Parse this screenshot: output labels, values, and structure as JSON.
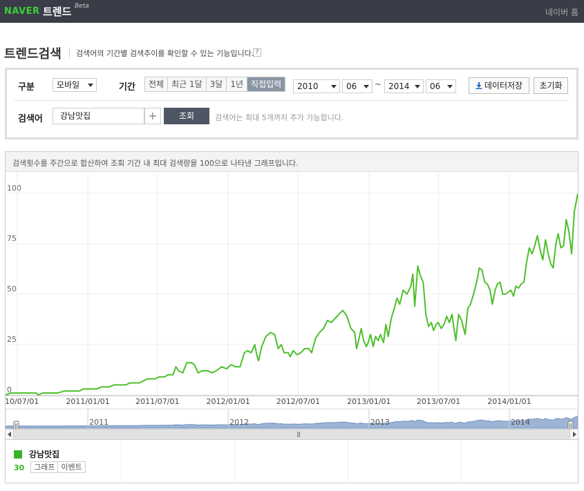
{
  "header": {
    "logo": "NAVER",
    "product": "트렌드",
    "beta": "Beta",
    "home_link": "네이버 홈"
  },
  "title": {
    "main": "트렌드검색",
    "description": "검색어의 기간별 검색추이를 확인할 수 있는 기능입니다.",
    "help": "?"
  },
  "search": {
    "device_label": "구분",
    "device_value": "모바일",
    "period_label": "기간",
    "period_options": [
      "전체",
      "최근 1달",
      "3달",
      "1년",
      "직접입력"
    ],
    "period_active": "직접입력",
    "start_year": "2010",
    "start_month": "06",
    "tilde": "~",
    "end_year": "2014",
    "end_month": "06",
    "save_label": "데이터저장",
    "reset_label": "초기화",
    "keyword_label": "검색어",
    "keyword_value": "강남맛집",
    "plus": "+",
    "submit_label": "조회",
    "keyword_note": "검색어는 최대 5개까지 추가 가능합니다."
  },
  "chart": {
    "note": "검색횟수를 주간으로 합산하여 조회 기간 내 최대 검색량을 100으로 나타낸 그래프입니다.",
    "nav_years": [
      "2011",
      "2012",
      "2013",
      "2014"
    ]
  },
  "legend": {
    "name": "강남맛집",
    "value": "30",
    "graph_btn": "그래프",
    "event_btn": "이벤트"
  },
  "colors": {
    "line": "#4cbf2a",
    "accent": "#3ccd3b",
    "topbar": "#3a3d47",
    "navigator_fill": "#9db4d4"
  },
  "chart_data": {
    "type": "line",
    "x_axis": "date",
    "y_ticks": [
      "100",
      "75",
      "50",
      "25",
      "0"
    ],
    "ylim": [
      0,
      100
    ],
    "x_tick_labels": [
      "2010/07/01",
      "2011/01/01",
      "2011/07/01",
      "2012/01/01",
      "2012/07/01",
      "2013/01/01",
      "2013/07/01",
      "2014/01/01"
    ],
    "series": [
      {
        "name": "강남맛집",
        "points": [
          [
            "2010-06-01",
            0
          ],
          [
            "2010-06-15",
            1
          ],
          [
            "2010-08-20",
            1
          ],
          [
            "2010-08-25",
            0
          ],
          [
            "2010-09-05",
            1
          ],
          [
            "2010-10-15",
            1
          ],
          [
            "2010-11-01",
            2
          ],
          [
            "2010-12-10",
            2
          ],
          [
            "2010-12-20",
            3
          ],
          [
            "2011-01-25",
            3
          ],
          [
            "2011-02-05",
            4
          ],
          [
            "2011-02-25",
            4
          ],
          [
            "2011-03-10",
            5
          ],
          [
            "2011-04-10",
            5
          ],
          [
            "2011-04-20",
            6
          ],
          [
            "2011-05-15",
            6
          ],
          [
            "2011-05-25",
            7
          ],
          [
            "2011-06-05",
            8
          ],
          [
            "2011-06-25",
            8
          ],
          [
            "2011-07-05",
            9
          ],
          [
            "2011-07-20",
            9
          ],
          [
            "2011-07-28",
            10
          ],
          [
            "2011-08-10",
            10
          ],
          [
            "2011-08-18",
            14
          ],
          [
            "2011-08-25",
            12
          ],
          [
            "2011-09-05",
            11
          ],
          [
            "2011-09-15",
            16
          ],
          [
            "2011-09-28",
            16
          ],
          [
            "2011-10-05",
            15
          ],
          [
            "2011-10-15",
            11
          ],
          [
            "2011-10-25",
            12
          ],
          [
            "2011-11-10",
            12
          ],
          [
            "2011-11-20",
            11
          ],
          [
            "2011-12-01",
            12
          ],
          [
            "2011-12-15",
            14
          ],
          [
            "2011-12-28",
            13
          ],
          [
            "2012-01-08",
            15
          ],
          [
            "2012-01-20",
            14
          ],
          [
            "2012-02-01",
            14
          ],
          [
            "2012-02-12",
            21
          ],
          [
            "2012-02-20",
            22
          ],
          [
            "2012-03-01",
            21
          ],
          [
            "2012-03-10",
            25
          ],
          [
            "2012-03-15",
            20
          ],
          [
            "2012-03-20",
            17
          ],
          [
            "2012-03-28",
            24
          ],
          [
            "2012-04-08",
            29
          ],
          [
            "2012-04-20",
            31
          ],
          [
            "2012-05-01",
            30
          ],
          [
            "2012-05-10",
            23
          ],
          [
            "2012-05-18",
            25
          ],
          [
            "2012-05-25",
            21
          ],
          [
            "2012-06-05",
            21
          ],
          [
            "2012-06-10",
            19
          ],
          [
            "2012-06-18",
            22
          ],
          [
            "2012-06-28",
            20
          ],
          [
            "2012-07-08",
            21
          ],
          [
            "2012-07-18",
            23
          ],
          [
            "2012-07-28",
            23
          ],
          [
            "2012-08-05",
            21
          ],
          [
            "2012-08-15",
            28
          ],
          [
            "2012-08-25",
            31
          ],
          [
            "2012-09-05",
            33
          ],
          [
            "2012-09-15",
            37
          ],
          [
            "2012-09-25",
            36
          ],
          [
            "2012-10-05",
            38
          ],
          [
            "2012-10-15",
            40
          ],
          [
            "2012-10-25",
            42
          ],
          [
            "2012-11-05",
            39
          ],
          [
            "2012-11-15",
            33
          ],
          [
            "2012-11-25",
            31
          ],
          [
            "2012-11-30",
            23
          ],
          [
            "2012-12-05",
            27
          ],
          [
            "2012-12-12",
            33
          ],
          [
            "2012-12-18",
            27
          ],
          [
            "2012-12-25",
            24
          ],
          [
            "2012-12-30",
            26
          ],
          [
            "2013-01-05",
            30
          ],
          [
            "2013-01-12",
            24
          ],
          [
            "2013-01-18",
            29
          ],
          [
            "2013-01-25",
            27
          ],
          [
            "2013-01-31",
            30
          ],
          [
            "2013-02-08",
            26
          ],
          [
            "2013-02-14",
            35
          ],
          [
            "2013-02-20",
            29
          ],
          [
            "2013-02-28",
            38
          ],
          [
            "2013-03-08",
            43
          ],
          [
            "2013-03-15",
            48
          ],
          [
            "2013-03-22",
            45
          ],
          [
            "2013-03-31",
            52
          ],
          [
            "2013-04-10",
            50
          ],
          [
            "2013-04-20",
            54
          ],
          [
            "2013-04-25",
            60
          ],
          [
            "2013-04-30",
            44
          ],
          [
            "2013-05-08",
            64
          ],
          [
            "2013-05-15",
            59
          ],
          [
            "2013-05-22",
            56
          ],
          [
            "2013-05-29",
            40
          ],
          [
            "2013-06-05",
            34
          ],
          [
            "2013-06-12",
            36
          ],
          [
            "2013-06-18",
            32
          ],
          [
            "2013-06-25",
            35
          ],
          [
            "2013-06-30",
            36
          ],
          [
            "2013-07-08",
            33
          ],
          [
            "2013-07-15",
            35
          ],
          [
            "2013-07-22",
            39
          ],
          [
            "2013-07-29",
            36
          ],
          [
            "2013-08-05",
            40
          ],
          [
            "2013-08-10",
            33
          ],
          [
            "2013-08-15",
            27
          ],
          [
            "2013-08-22",
            40
          ],
          [
            "2013-08-30",
            37
          ],
          [
            "2013-09-08",
            30
          ],
          [
            "2013-09-15",
            43
          ],
          [
            "2013-09-22",
            45
          ],
          [
            "2013-09-30",
            50
          ],
          [
            "2013-10-08",
            56
          ],
          [
            "2013-10-15",
            63
          ],
          [
            "2013-10-22",
            62
          ],
          [
            "2013-10-29",
            56
          ],
          [
            "2013-11-05",
            55
          ],
          [
            "2013-11-12",
            52
          ],
          [
            "2013-11-18",
            45
          ],
          [
            "2013-11-25",
            52
          ],
          [
            "2013-12-01",
            55
          ],
          [
            "2013-12-08",
            56
          ],
          [
            "2013-12-15",
            50
          ],
          [
            "2013-12-22",
            50
          ],
          [
            "2013-12-29",
            51
          ],
          [
            "2014-01-05",
            52
          ],
          [
            "2014-01-12",
            49
          ],
          [
            "2014-01-18",
            54
          ],
          [
            "2014-01-25",
            53
          ],
          [
            "2014-02-01",
            55
          ],
          [
            "2014-02-08",
            56
          ],
          [
            "2014-02-15",
            66
          ],
          [
            "2014-02-22",
            73
          ],
          [
            "2014-03-01",
            70
          ],
          [
            "2014-03-08",
            74
          ],
          [
            "2014-03-15",
            79
          ],
          [
            "2014-03-22",
            72
          ],
          [
            "2014-03-29",
            67
          ],
          [
            "2014-04-05",
            77
          ],
          [
            "2014-04-12",
            70
          ],
          [
            "2014-04-19",
            65
          ],
          [
            "2014-04-25",
            63
          ],
          [
            "2014-05-02",
            75
          ],
          [
            "2014-05-08",
            80
          ],
          [
            "2014-05-15",
            73
          ],
          [
            "2014-05-22",
            74
          ],
          [
            "2014-05-29",
            87
          ],
          [
            "2014-06-05",
            81
          ],
          [
            "2014-06-12",
            70
          ],
          [
            "2014-06-19",
            91
          ],
          [
            "2014-06-28",
            100
          ]
        ]
      }
    ]
  }
}
